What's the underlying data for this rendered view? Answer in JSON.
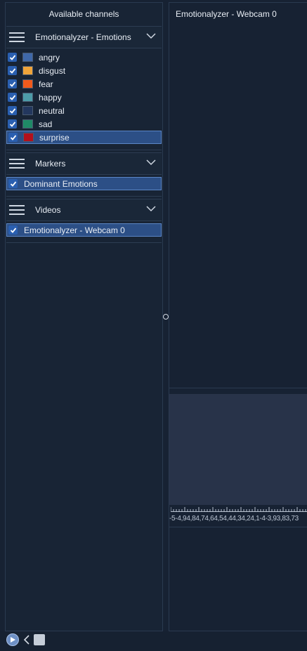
{
  "left_panel": {
    "title": "Available channels",
    "groups": [
      {
        "label": "Emotionalyzer - Emotions",
        "items": [
          {
            "label": "angry",
            "color": "#3f68a9"
          },
          {
            "label": "disgust",
            "color": "#f0a43a"
          },
          {
            "label": "fear",
            "color": "#f05a1c"
          },
          {
            "label": "happy",
            "color": "#4d9ca8"
          },
          {
            "label": "neutral",
            "color": "#23375e"
          },
          {
            "label": "sad",
            "color": "#1f8a66"
          },
          {
            "label": "surprise",
            "color": "#b3101c"
          }
        ]
      },
      {
        "label": "Markers",
        "items": [
          {
            "label": "Dominant Emotions"
          }
        ]
      },
      {
        "label": "Videos",
        "items": [
          {
            "label": "Emotionalyzer - Webcam 0"
          }
        ]
      }
    ]
  },
  "right_panel": {
    "video_title": "Emotionalyzer - Webcam 0",
    "ruler_labels": "-5-4,94,84,74,64,54,44,34,24,1-4-3,93,83,73"
  },
  "bottom_bar": {
    "icons": [
      "play-icon",
      "chevron-left-icon",
      "stop-icon"
    ]
  }
}
